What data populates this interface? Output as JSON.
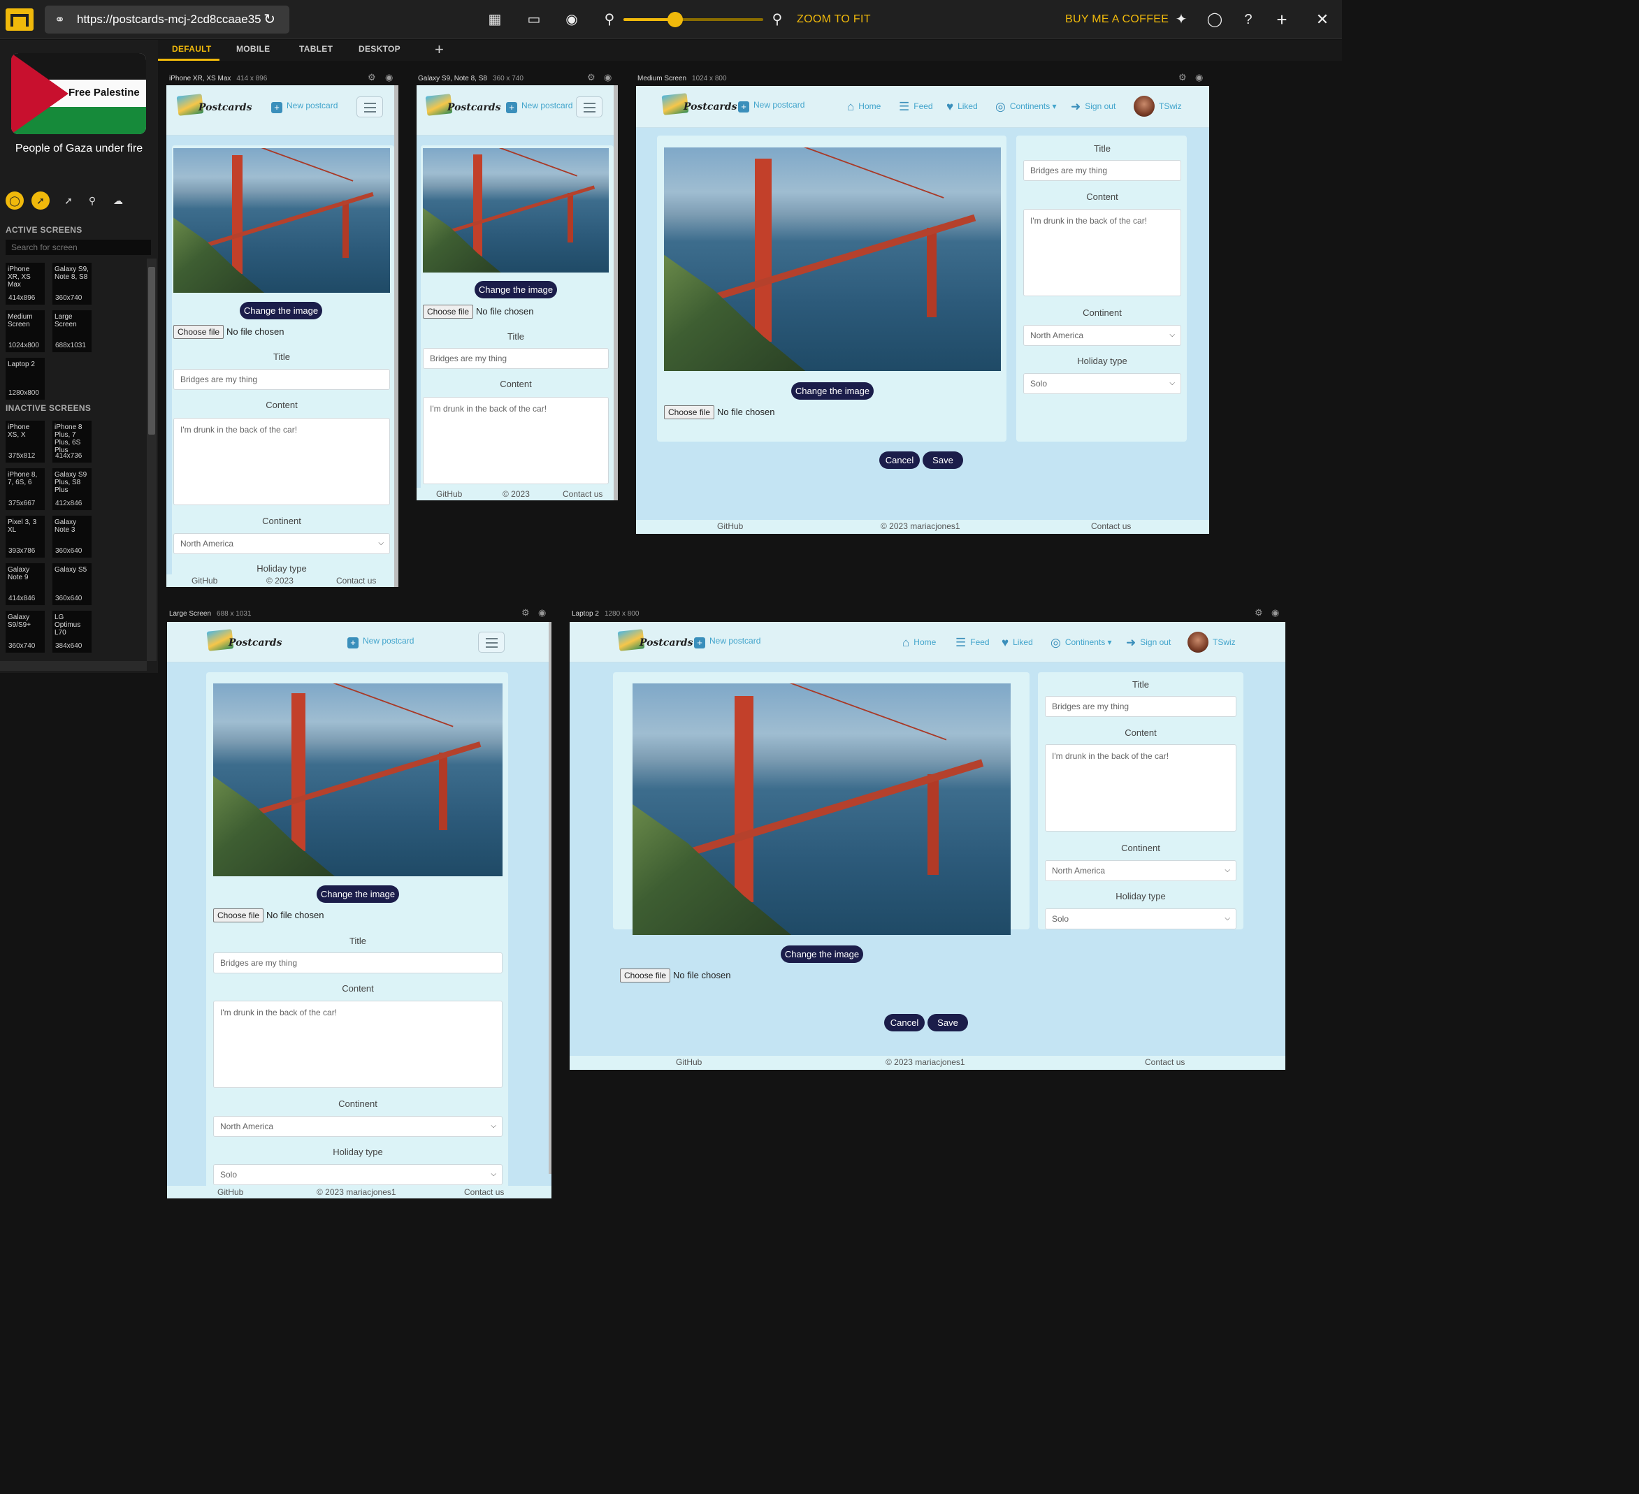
{
  "toolbar": {
    "url": "https://postcards-mcj-2cd8ccaae35",
    "zoom_to_fit": "ZOOM TO FIT",
    "buy_coffee": "BUY ME A COFFEE",
    "zoom_level": 0.37,
    "accent_color": "#f0b90b"
  },
  "sidebar": {
    "banner_text": "Free Palestine",
    "caption": "People of Gaza under fire",
    "active_header": "ACTIVE SCREENS",
    "search_placeholder": "Search for screen",
    "inactive_header": "INACTIVE SCREENS",
    "active": [
      {
        "name": "iPhone XR, XS Max",
        "res": "414x896"
      },
      {
        "name": "Galaxy S9, Note 8, S8",
        "res": "360x740"
      },
      {
        "name": "Medium Screen",
        "res": "1024x800"
      },
      {
        "name": "Large Screen",
        "res": "688x1031"
      },
      {
        "name": "Laptop 2",
        "res": "1280x800"
      }
    ],
    "inactive": [
      {
        "name": "iPhone XS, X",
        "res": "375x812"
      },
      {
        "name": "iPhone 8 Plus, 7 Plus, 6S Plus",
        "res": "414x736"
      },
      {
        "name": "iPhone 8, 7, 6S, 6",
        "res": "375x667"
      },
      {
        "name": "Galaxy S9 Plus, S8 Plus",
        "res": "412x846"
      },
      {
        "name": "Pixel 3, 3 XL",
        "res": "393x786"
      },
      {
        "name": "Galaxy Note 3",
        "res": "360x640"
      },
      {
        "name": "Galaxy Note 9",
        "res": "414x846"
      },
      {
        "name": "Galaxy S5",
        "res": "360x640"
      },
      {
        "name": "Galaxy S9/S9+",
        "res": "360x740"
      },
      {
        "name": "LG Optimus L70",
        "res": "384x640"
      }
    ]
  },
  "tabs": [
    "DEFAULT",
    "MOBILE",
    "TABLET",
    "DESKTOP"
  ],
  "frames": {
    "f1": {
      "name": "iPhone XR, XS Max",
      "size": "414 x 896"
    },
    "f2": {
      "name": "Galaxy S9, Note 8, S8",
      "size": "360 x 740"
    },
    "f3": {
      "name": "Medium Screen",
      "size": "1024 x 800"
    },
    "f4": {
      "name": "Large Screen",
      "size": "688 x 1031"
    },
    "f5": {
      "name": "Laptop 2",
      "size": "1280 x 800"
    }
  },
  "app": {
    "brand": "Postcards",
    "new_postcard": "New postcard",
    "nav": {
      "home": "Home",
      "feed": "Feed",
      "liked": "Liked",
      "continents": "Continents",
      "sign_out": "Sign out",
      "user": "TSwiz"
    },
    "change_image": "Change the image",
    "choose_file": "Choose file",
    "no_file": "No file chosen",
    "title_label": "Title",
    "title_value": "Bridges are my thing",
    "content_label": "Content",
    "content_value": "I'm drunk in the back of the car!",
    "continent_label": "Continent",
    "continent_value": "North America",
    "holiday_label": "Holiday type",
    "holiday_value": "Solo",
    "cancel": "Cancel",
    "save": "Save",
    "footer": {
      "github": "GitHub",
      "copyright": "© 2023 mariacjones1",
      "copyright_short": "© 2023",
      "contact": "Contact us"
    }
  }
}
